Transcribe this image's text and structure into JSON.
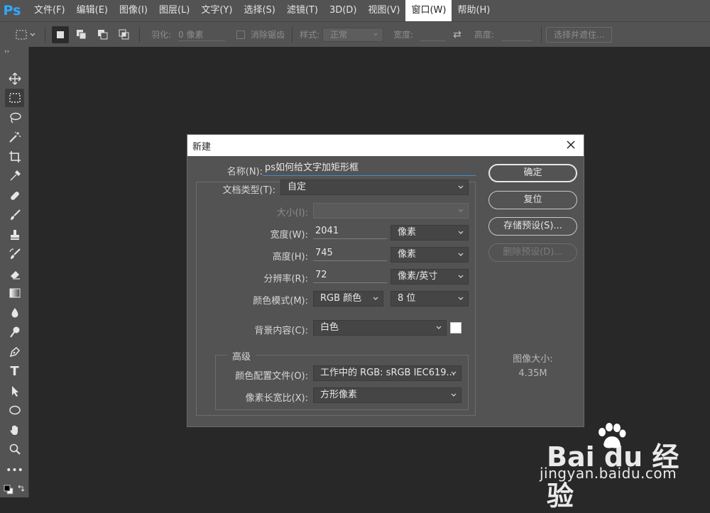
{
  "app": {
    "logo": "Ps"
  },
  "menu": [
    "文件(F)",
    "编辑(E)",
    "图像(I)",
    "图层(L)",
    "文字(Y)",
    "选择(S)",
    "滤镜(T)",
    "3D(D)",
    "视图(V)",
    "窗口(W)",
    "帮助(H)"
  ],
  "menu_active": "窗口(W)",
  "options": {
    "feather_label": "羽化:",
    "feather_value": "0 像素",
    "antialias_label": "消除锯齿",
    "style_label": "样式:",
    "style_value": "正常",
    "width_label": "宽度:",
    "height_label": "高度:",
    "select_mask_button": "选择并遮住..."
  },
  "dialog": {
    "title": "新建",
    "name_label": "名称(N):",
    "name_value": "ps如何给文字加矩形框",
    "doc_type_label": "文档类型(T):",
    "doc_type_value": "自定",
    "size_label": "大小(I):",
    "width_label": "宽度(W):",
    "width_value": "2041",
    "width_unit": "像素",
    "height_label": "高度(H):",
    "height_value": "745",
    "height_unit": "像素",
    "resolution_label": "分辨率(R):",
    "resolution_value": "72",
    "resolution_unit": "像素/英寸",
    "color_mode_label": "颜色模式(M):",
    "color_mode_value": "RGB 颜色",
    "bit_depth": "8 位",
    "bg_label": "背景内容(C):",
    "bg_value": "白色",
    "advanced_label": "高级",
    "color_profile_label": "颜色配置文件(O):",
    "color_profile_value": "工作中的 RGB:  sRGB IEC619...",
    "pixel_aspect_label": "像素长宽比(X):",
    "pixel_aspect_value": "方形像素",
    "ok_button": "确定",
    "reset_button": "复位",
    "save_preset_button": "存储预设(S)...",
    "delete_preset_button": "删除预设(D)...",
    "image_size_label": "图像大小:",
    "image_size_value": "4.35M"
  },
  "watermark": {
    "logo": "Bai du 经验",
    "url": "jingyan.baidu.com"
  }
}
